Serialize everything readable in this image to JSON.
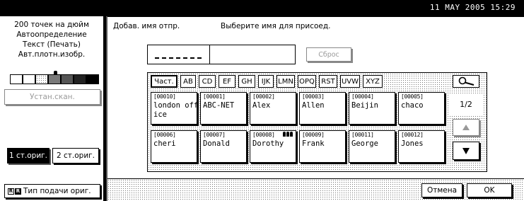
{
  "status_bar": {
    "datetime": "11  MAY   2005 15:29"
  },
  "left_panel": {
    "status_lines": [
      "200 точек на дюйм",
      "Автоопределение",
      "Текст (Печать)",
      "Авт.плотн.изобр."
    ],
    "scan_settings_button": "Устан.скан.",
    "original_one_sided": "1 ст.ориг.",
    "original_two_sided": "2 ст.ориг.",
    "feed_type_button": "Тип подачи ориг."
  },
  "header": {
    "add_sender_label": "Добав. имя отпр.",
    "instruction": "Выберите имя для присоед."
  },
  "name_entry": {
    "value": "",
    "clear_button": "Сброс"
  },
  "tabs": [
    {
      "label": "Част.",
      "selected": true
    },
    {
      "label": "AB"
    },
    {
      "label": "CD"
    },
    {
      "label": "EF"
    },
    {
      "label": "GH"
    },
    {
      "label": "IJK"
    },
    {
      "label": "LMN"
    },
    {
      "label": "OPQ"
    },
    {
      "label": "RST"
    },
    {
      "label": "UVW"
    },
    {
      "label": "XYZ"
    }
  ],
  "search_icon": "magnifier-icon",
  "entries": [
    {
      "id": "[00010]",
      "name": "london office"
    },
    {
      "id": "[00001]",
      "name": "ABC-NET"
    },
    {
      "id": "[00002]",
      "name": "Alex"
    },
    {
      "id": "[00003]",
      "name": "Allen"
    },
    {
      "id": "[00004]",
      "name": "Beijin"
    },
    {
      "id": "[00005]",
      "name": "chaco"
    },
    {
      "id": "[00006]",
      "name": "cheri"
    },
    {
      "id": "[00007]",
      "name": "Donald"
    },
    {
      "id": "[00008]",
      "name": "Dorothy",
      "group_icon": true
    },
    {
      "id": "[00009]",
      "name": "Frank"
    },
    {
      "id": "[00011]",
      "name": "George"
    },
    {
      "id": "[00012]",
      "name": "Jones"
    }
  ],
  "pager": {
    "page": "1/2",
    "up_icon": "up-triangle-icon",
    "down_icon": "down-triangle-icon"
  },
  "footer": {
    "cancel_button": "Отмена",
    "ok_button": "OK"
  },
  "colors": {
    "background": "#ffffff",
    "foreground": "#000000",
    "disabled": "#9a9a9a"
  }
}
